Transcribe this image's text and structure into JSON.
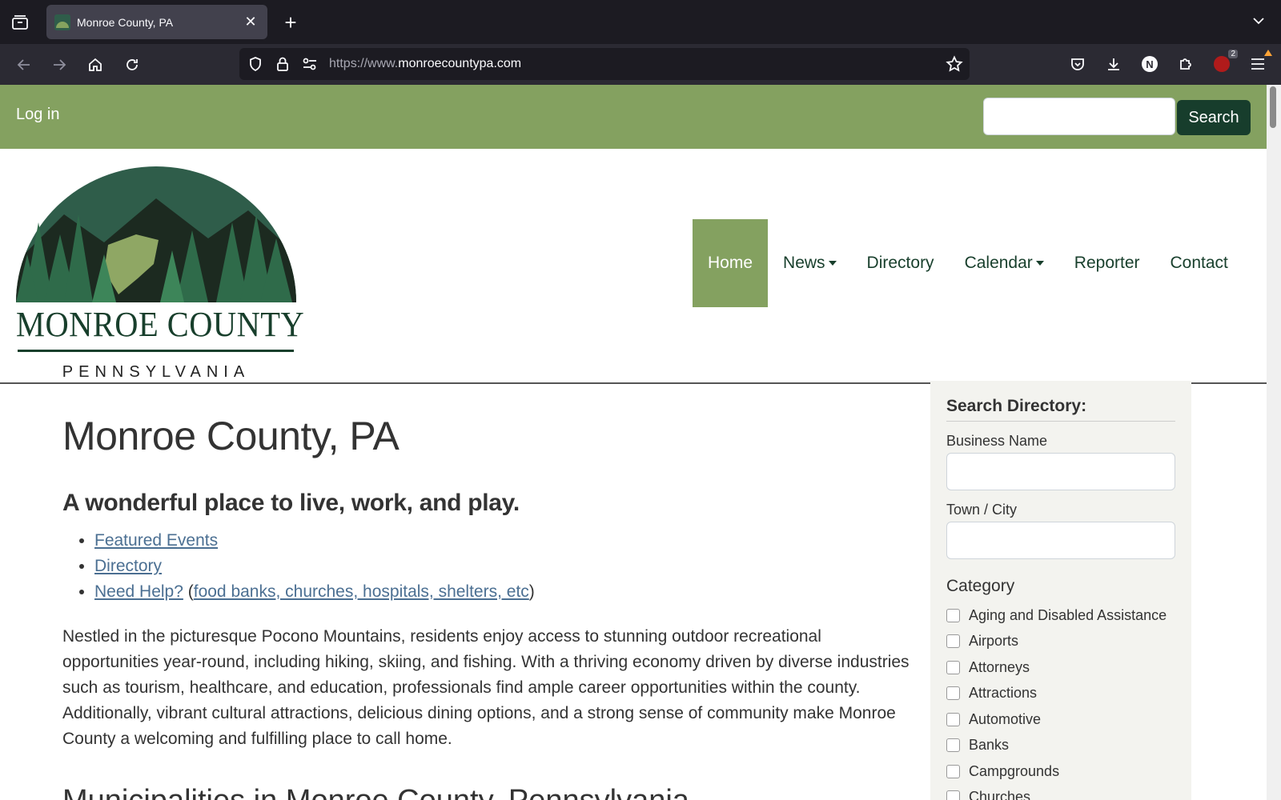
{
  "browser": {
    "tab_title": "Monroe County, PA",
    "url_prefix": "https://www.",
    "url_domain": "monroecountypa.com",
    "extension_badge": "2"
  },
  "topbar": {
    "login_label": "Log in",
    "search_label": "Search"
  },
  "logo": {
    "title": "MONROE COUNTY",
    "subtitle": "PENNSYLVANIA"
  },
  "nav": {
    "items": [
      {
        "label": "Home"
      },
      {
        "label": "News"
      },
      {
        "label": "Directory"
      },
      {
        "label": "Calendar"
      },
      {
        "label": "Reporter"
      },
      {
        "label": "Contact"
      }
    ]
  },
  "main": {
    "title": "Monroe County, PA",
    "tagline": "A wonderful place to live, work, and play.",
    "links": {
      "featured": "Featured Events",
      "directory": "Directory",
      "help": "Need Help?",
      "help_detail": "food banks, churches, hospitals, shelters, etc"
    },
    "intro": "Nestled in the picturesque Pocono Mountains, residents enjoy access to stunning outdoor recreational opportunities year-round, including hiking, skiing, and fishing. With a thriving economy driven by diverse industries such as tourism, healthcare, and education, professionals find ample career opportunities within the county. Additionally, vibrant cultural attractions, delicious dining options, and a strong sense of community make Monroe County a welcoming and fulfilling place to call home.",
    "section_title": "Municipalities in Monroe County, Pennsylvania"
  },
  "sidebar": {
    "title": "Search Directory:",
    "business_label": "Business Name",
    "town_label": "Town / City",
    "category_label": "Category",
    "categories": [
      "Aging and Disabled Assistance",
      "Airports",
      "Attorneys",
      "Attractions",
      "Automotive",
      "Banks",
      "Campgrounds",
      "Churches"
    ]
  }
}
